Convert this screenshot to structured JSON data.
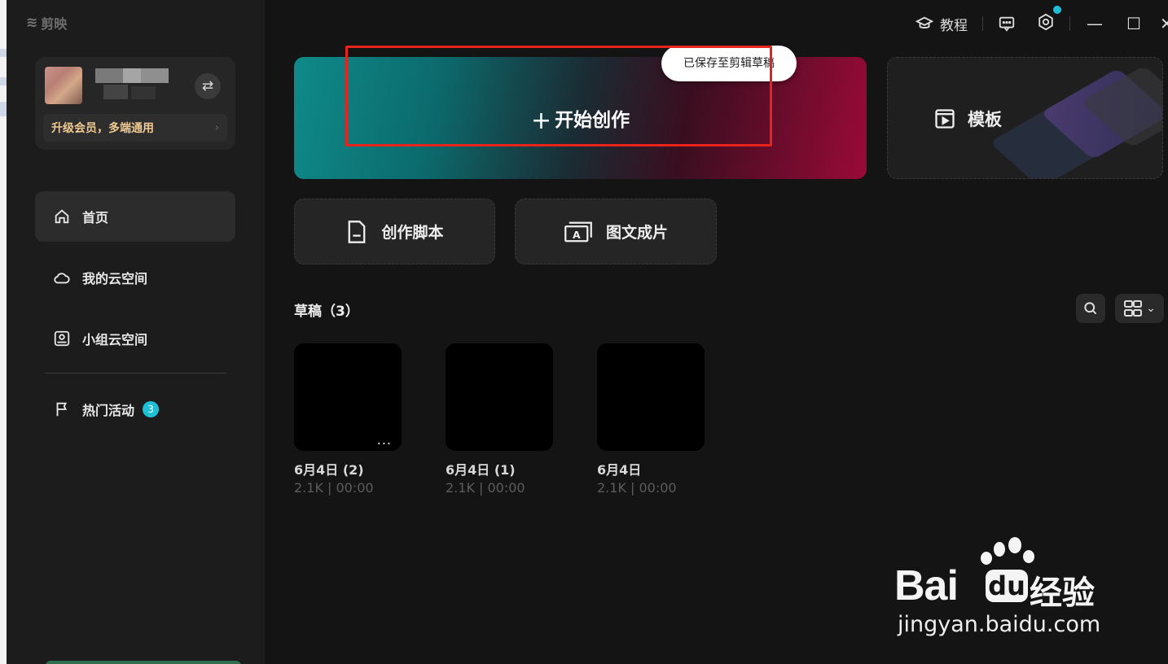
{
  "app": {
    "name": "剪映"
  },
  "titlebar": {
    "tutorial_label": "教程",
    "tutorial_icon": "graduation-cap-icon",
    "feedback_icon": "message-icon",
    "settings_icon": "gear-icon",
    "minimize_label": "—",
    "maximize_label": "☐",
    "close_label": "✕",
    "accent": "#1ec0d6"
  },
  "user": {
    "upgrade_label": "升级会员，多端通用",
    "upgrade_chevron": "›",
    "swap_label": "⇄"
  },
  "sidebar": {
    "items": [
      {
        "label": "首页",
        "icon": "home-icon",
        "active": true
      },
      {
        "label": "我的云空间",
        "icon": "cloud-icon",
        "active": false
      },
      {
        "label": "小组云空间",
        "icon": "group-cloud-icon",
        "active": false
      },
      {
        "label": "热门活动",
        "icon": "flag-icon",
        "active": false,
        "badge": "3"
      }
    ]
  },
  "hero": {
    "create_label": "开始创作",
    "plus": "+",
    "saved_toast": "已保存至剪辑草稿",
    "gradient_start": "#0f8a8a",
    "gradient_end": "#9a0a38",
    "highlight_color": "#e8231b"
  },
  "template": {
    "label": "模板",
    "icon": "template-icon"
  },
  "tools": [
    {
      "label": "创作脚本",
      "icon": "script-doc-icon"
    },
    {
      "label": "图文成片",
      "icon": "text-to-video-icon"
    }
  ],
  "drafts": {
    "title": "草稿（3）",
    "items": [
      {
        "name": "6月4日 (2)",
        "meta": "2.1K | 00:00",
        "more": "..."
      },
      {
        "name": "6月4日 (1)",
        "meta": "2.1K | 00:00"
      },
      {
        "name": "6月4日",
        "meta": "2.1K | 00:00"
      }
    ],
    "view_toggle_chevron": "⌄"
  },
  "watermark": {
    "brand_text": "Bai",
    "du_text": "du",
    "cn_text": "经验",
    "url": "jingyan.baidu.com"
  }
}
